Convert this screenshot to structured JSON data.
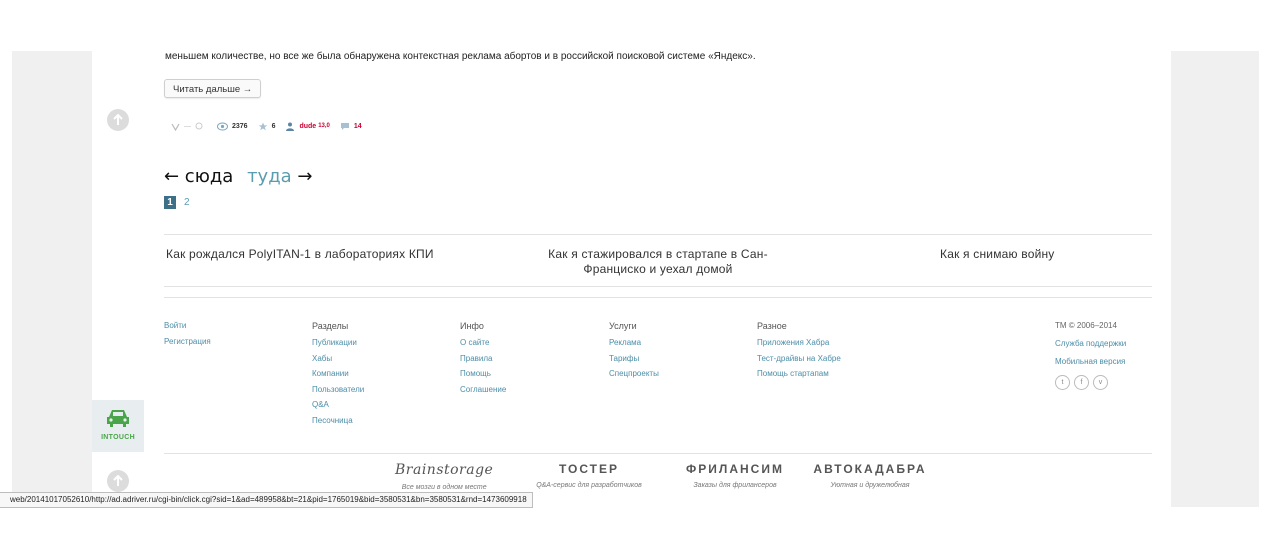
{
  "article": {
    "text_tail": "меньшем количестве, но все же была обнаружена контекстная реклама абортов и в российской поисковой системе «Яндекс».",
    "read_more": "Читать дальше →"
  },
  "stats": {
    "votes": "—",
    "views": "2376",
    "favorites": "6",
    "author": "dude",
    "author_karma": "13,0",
    "comments": "14"
  },
  "pager": {
    "prev_label": "← сюда",
    "next_label": "туда",
    "next_arrow": "→",
    "current_page": "1",
    "other_page": "2"
  },
  "related": [
    "Как рождался PolyITAN-1 в лабораториях КПИ",
    "Как я стажировался в стартапе в Сан-Франциско и уехал домой",
    "Как я снимаю войну"
  ],
  "footer": {
    "auth": [
      "Войти",
      "Регистрация"
    ],
    "sections": {
      "title": "Разделы",
      "links": [
        "Публикации",
        "Хабы",
        "Компании",
        "Пользователи",
        "Q&A",
        "Песочница"
      ]
    },
    "info": {
      "title": "Инфо",
      "links": [
        "О сайте",
        "Правила",
        "Помощь",
        "Соглашение"
      ]
    },
    "services": {
      "title": "Услуги",
      "links": [
        "Реклама",
        "Тарифы",
        "Спецпроекты"
      ]
    },
    "misc": {
      "title": "Разное",
      "links": [
        "Приложения Хабра",
        "Тест-драйвы на Хабре",
        "Помощь стартапам"
      ]
    },
    "copyright": "TM © 2006–2014",
    "support": "Служба поддержки",
    "mobile": "Мобильная версия"
  },
  "brands": [
    {
      "name": "Brainstorage",
      "tag": "Все мозги в одном месте"
    },
    {
      "name": "ТОСТЕР",
      "tag": "Q&A-сервис для разработчиков"
    },
    {
      "name": "ФРИЛАНСИМ",
      "tag": "Заказы для фрилансеров"
    },
    {
      "name": "АВТОКАДАБРА",
      "tag": "Уютная и дружелюбная"
    }
  ],
  "intouch_label": "INTOUCH",
  "status_url": "web/20141017052610/http://ad.adriver.ru/cgi-bin/click.cgi?sid=1&ad=489958&bt=21&pid=1765019&bid=3580531&bn=3580531&rnd=1473609918",
  "colors": {
    "link": "#4c8ea8",
    "accent": "#5b9db0",
    "red": "#cc0033",
    "intouch_green": "#4aa54a"
  }
}
